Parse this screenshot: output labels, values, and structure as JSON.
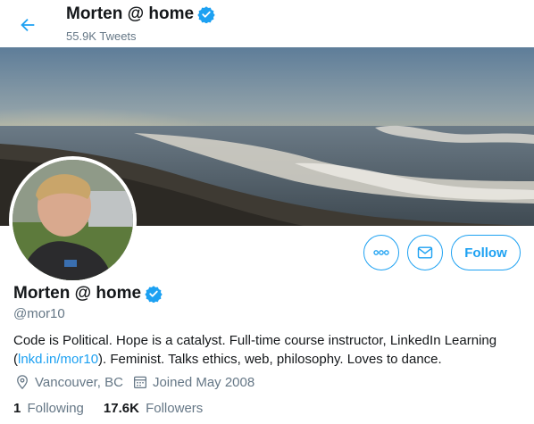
{
  "header": {
    "name": "Morten @ home",
    "tweet_count": "55.9K Tweets"
  },
  "icons": {
    "back": "back-arrow-icon",
    "verified": "verified-badge-icon",
    "more": "more-dots-icon",
    "message": "envelope-icon",
    "location": "location-pin-icon",
    "calendar": "calendar-icon"
  },
  "profile": {
    "name": "Morten @ home",
    "handle": "@mor10",
    "bio_before_link": "Code is Political. Hope is a catalyst. Full-time course instructor, LinkedIn Learning (",
    "bio_link": "lnkd.in/mor10",
    "bio_after_link": "). Feminist. Talks ethics, web, philosophy. Loves to dance.",
    "location": "Vancouver, BC",
    "joined": "Joined May 2008"
  },
  "actions": {
    "follow_label": "Follow"
  },
  "stats": {
    "following_count": "1",
    "following_label": "Following",
    "followers_count": "17.6K",
    "followers_label": "Followers"
  },
  "colors": {
    "accent": "#1da1f2",
    "secondary_text": "#657786",
    "primary_text": "#14171a"
  }
}
